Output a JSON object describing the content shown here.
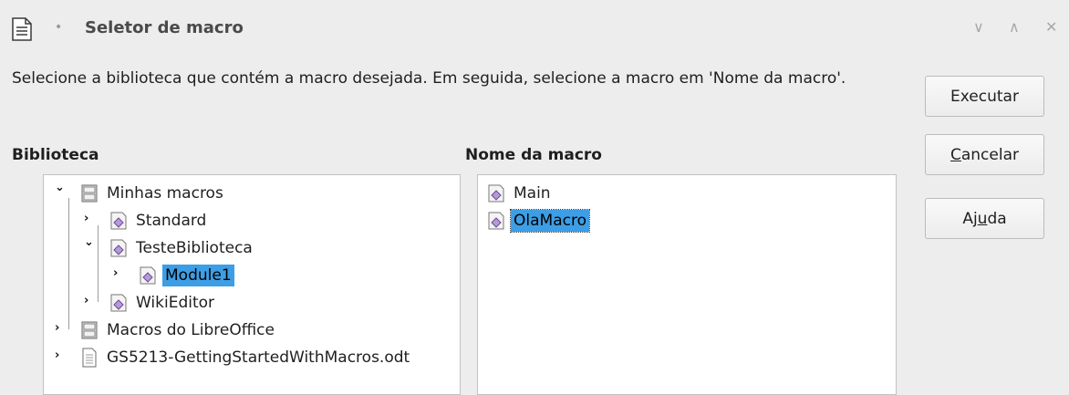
{
  "window": {
    "title": "Seletor de macro",
    "separator": "•",
    "min_glyph": "∨",
    "max_glyph": "∧",
    "close_glyph": "✕"
  },
  "instruction": "Selecione a biblioteca que contém a macro desejada. Em seguida, selecione a macro em 'Nome da macro'.",
  "library": {
    "label": "Biblioteca",
    "items": [
      {
        "label": "Minhas macros",
        "icon": "library-container-icon",
        "state": "expanded"
      },
      {
        "label": "Standard",
        "icon": "basic-library-icon",
        "state": "collapsed"
      },
      {
        "label": "TesteBiblioteca",
        "icon": "basic-library-icon",
        "state": "expanded"
      },
      {
        "label": "Module1",
        "icon": "basic-module-icon",
        "state": "collapsed",
        "selected": true
      },
      {
        "label": "WikiEditor",
        "icon": "basic-library-icon",
        "state": "collapsed"
      },
      {
        "label": "Macros do LibreOffice",
        "icon": "library-container-icon",
        "state": "collapsed"
      },
      {
        "label": "GS5213-GettingStartedWithMacros.odt",
        "icon": "document-icon",
        "state": "collapsed"
      }
    ]
  },
  "macros": {
    "label": "Nome da macro",
    "items": [
      {
        "label": "Main",
        "icon": "macro-icon"
      },
      {
        "label": "OlaMacro",
        "icon": "macro-icon",
        "selected": true
      }
    ]
  },
  "buttons": {
    "execute": "Executar",
    "cancel_accel": "C",
    "cancel_rest": "ancelar",
    "help_pre": "Aj",
    "help_accel": "u",
    "help_post": "da"
  },
  "colors": {
    "selection": "#3d9ee5",
    "dialog_bg": "#ededed",
    "panel_bg": "#ffffff"
  }
}
